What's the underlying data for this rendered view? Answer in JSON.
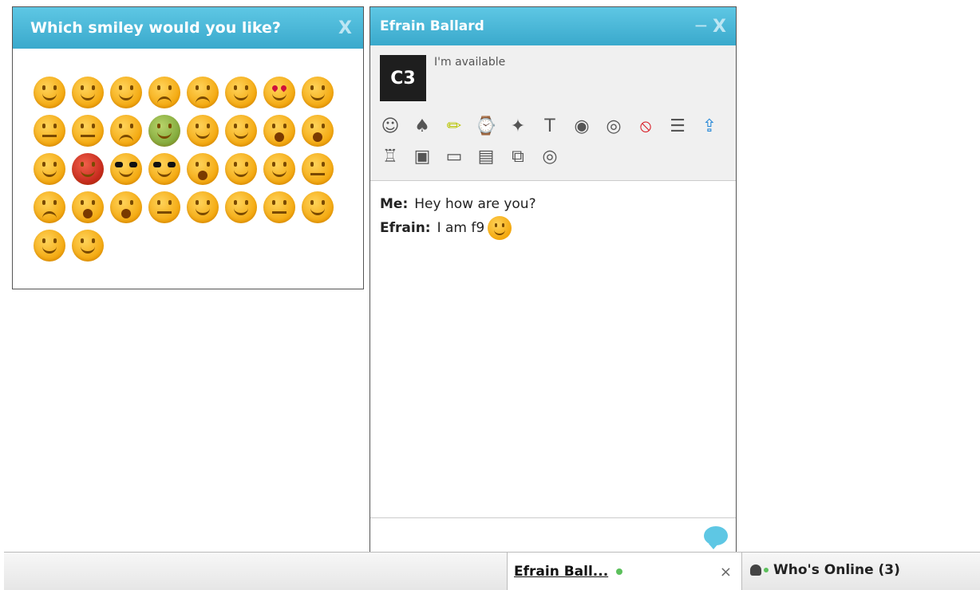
{
  "smiley_picker": {
    "title": "Which smiley would you like?",
    "close": "X",
    "smileys": [
      "smile",
      "smile",
      "grin",
      "sad",
      "cry",
      "tongue",
      "love",
      "kiss",
      "flat",
      "sleepy",
      "confused",
      "sick",
      "angry",
      "blush",
      "surprised",
      "shocked",
      "zipped",
      "devil",
      "cool",
      "nerd",
      "whistle",
      "happy",
      "wink",
      "smirk",
      "worried",
      "laugh",
      "ooh",
      "meh",
      "sweat",
      "tongue",
      "squint",
      "dizzy",
      "blush",
      "evil"
    ]
  },
  "chat": {
    "title": "Efrain Ballard",
    "minimize": "_",
    "close": "X",
    "avatar_text": "C3",
    "status": "I'm available",
    "tools": [
      "smiley-icon",
      "cards-icon",
      "pencil-icon",
      "clock-icon",
      "broom-icon",
      "text-format-icon",
      "webcam-icon",
      "target-icon",
      "block-icon",
      "notes-icon",
      "upload-icon",
      "castle-icon",
      "save-icon",
      "screen-icon",
      "whiteboard-icon",
      "documents-icon",
      "broadcast-icon"
    ],
    "messages": [
      {
        "sender": "Me:",
        "text": "Hey how are you?"
      },
      {
        "sender": "Efrain:",
        "text": "I am f9"
      }
    ]
  },
  "bottombar": {
    "chat_tab_label": "Efrain Ball...",
    "tab_close": "×",
    "whos_online": "Who's Online (3)"
  }
}
